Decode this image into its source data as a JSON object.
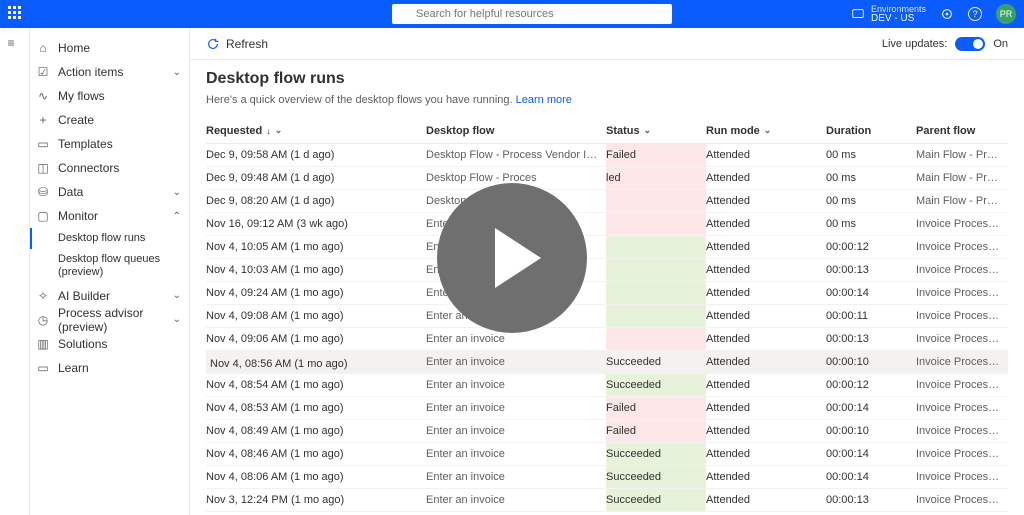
{
  "header": {
    "search_placeholder": "Search for helpful resources",
    "env_label": "Environments",
    "env_value": "DEV - US",
    "avatar": "PR"
  },
  "commandbar": {
    "refresh": "Refresh",
    "live_updates_label": "Live updates:",
    "live_updates_state": "On"
  },
  "nav": {
    "home": "Home",
    "action_items": "Action items",
    "my_flows": "My flows",
    "create": "Create",
    "templates": "Templates",
    "connectors": "Connectors",
    "data": "Data",
    "monitor": "Monitor",
    "monitor_sub": {
      "desktop_flow_runs": "Desktop flow runs",
      "desktop_flow_queues": "Desktop flow queues (preview)"
    },
    "ai_builder": "AI Builder",
    "process_advisor": "Process advisor (preview)",
    "solutions": "Solutions",
    "learn": "Learn"
  },
  "page": {
    "title": "Desktop flow runs",
    "subtitle_text": "Here's a quick overview of the desktop flows you have running. ",
    "learn_more": "Learn more"
  },
  "columns": {
    "requested": "Requested",
    "desktop_flow": "Desktop flow",
    "status": "Status",
    "run_mode": "Run mode",
    "duration": "Duration",
    "parent_flow": "Parent flow"
  },
  "rows": [
    {
      "requested": "Dec 9, 09:58 AM (1 d ago)",
      "flow": "Desktop Flow - Process Vendor Invoices",
      "status": "Failed",
      "status_kind": "fail",
      "mode": "Attended",
      "duration": "00 ms",
      "parent": "Main Flow - Process AI Builder Docu...",
      "hover": false
    },
    {
      "requested": "Dec 9, 09:48 AM (1 d ago)",
      "flow": "Desktop Flow - Proces",
      "status": "led",
      "status_kind": "fail",
      "mode": "Attended",
      "duration": "00 ms",
      "parent": "Main Flow - Process AI Builder Docu...",
      "hover": false
    },
    {
      "requested": "Dec 9, 08:20 AM (1 d ago)",
      "flow": "Desktop Flow -",
      "status": "",
      "status_kind": "fail",
      "mode": "Attended",
      "duration": "00 ms",
      "parent": "Main Flow - Process AI Builder Docu...",
      "hover": false
    },
    {
      "requested": "Nov 16, 09:12 AM (3 wk ago)",
      "flow": "Enter an in",
      "status": "",
      "status_kind": "fail",
      "mode": "Attended",
      "duration": "00 ms",
      "parent": "Invoice Processing",
      "hover": false
    },
    {
      "requested": "Nov 4, 10:05 AM (1 mo ago)",
      "flow": "Enter an",
      "status": "",
      "status_kind": "succ",
      "mode": "Attended",
      "duration": "00:00:12",
      "parent": "Invoice Processing",
      "hover": false
    },
    {
      "requested": "Nov 4, 10:03 AM (1 mo ago)",
      "flow": "Enter an",
      "status": "",
      "status_kind": "succ",
      "mode": "Attended",
      "duration": "00:00:13",
      "parent": "Invoice Processing",
      "hover": false
    },
    {
      "requested": "Nov 4, 09:24 AM (1 mo ago)",
      "flow": "Enter an",
      "status": "",
      "status_kind": "succ",
      "mode": "Attended",
      "duration": "00:00:14",
      "parent": "Invoice Processing",
      "hover": false
    },
    {
      "requested": "Nov 4, 09:08 AM (1 mo ago)",
      "flow": "Enter an in",
      "status": "",
      "status_kind": "succ",
      "mode": "Attended",
      "duration": "00:00:11",
      "parent": "Invoice Processing",
      "hover": false
    },
    {
      "requested": "Nov 4, 09:06 AM (1 mo ago)",
      "flow": "Enter an invoice",
      "status": "",
      "status_kind": "fail",
      "mode": "Attended",
      "duration": "00:00:13",
      "parent": "Invoice Processing",
      "hover": false
    },
    {
      "requested": "Nov 4, 08:56 AM (1 mo ago)",
      "flow": "Enter an invoice",
      "status": "Succeeded",
      "status_kind": "succ",
      "mode": "Attended",
      "duration": "00:00:10",
      "parent": "Invoice Processing",
      "hover": true
    },
    {
      "requested": "Nov 4, 08:54 AM (1 mo ago)",
      "flow": "Enter an invoice",
      "status": "Succeeded",
      "status_kind": "succ",
      "mode": "Attended",
      "duration": "00:00:12",
      "parent": "Invoice Processing",
      "hover": false
    },
    {
      "requested": "Nov 4, 08:53 AM (1 mo ago)",
      "flow": "Enter an invoice",
      "status": "Failed",
      "status_kind": "fail",
      "mode": "Attended",
      "duration": "00:00:14",
      "parent": "Invoice Processing",
      "hover": false
    },
    {
      "requested": "Nov 4, 08:49 AM (1 mo ago)",
      "flow": "Enter an invoice",
      "status": "Failed",
      "status_kind": "fail",
      "mode": "Attended",
      "duration": "00:00:10",
      "parent": "Invoice Processing",
      "hover": false
    },
    {
      "requested": "Nov 4, 08:46 AM (1 mo ago)",
      "flow": "Enter an invoice",
      "status": "Succeeded",
      "status_kind": "succ",
      "mode": "Attended",
      "duration": "00:00:14",
      "parent": "Invoice Processing",
      "hover": false
    },
    {
      "requested": "Nov 4, 08:06 AM (1 mo ago)",
      "flow": "Enter an invoice",
      "status": "Succeeded",
      "status_kind": "succ",
      "mode": "Attended",
      "duration": "00:00:14",
      "parent": "Invoice Processing",
      "hover": false
    },
    {
      "requested": "Nov 3, 12:24 PM (1 mo ago)",
      "flow": "Enter an invoice",
      "status": "Succeeded",
      "status_kind": "succ",
      "mode": "Attended",
      "duration": "00:00:13",
      "parent": "Invoice Processing",
      "hover": false
    }
  ]
}
